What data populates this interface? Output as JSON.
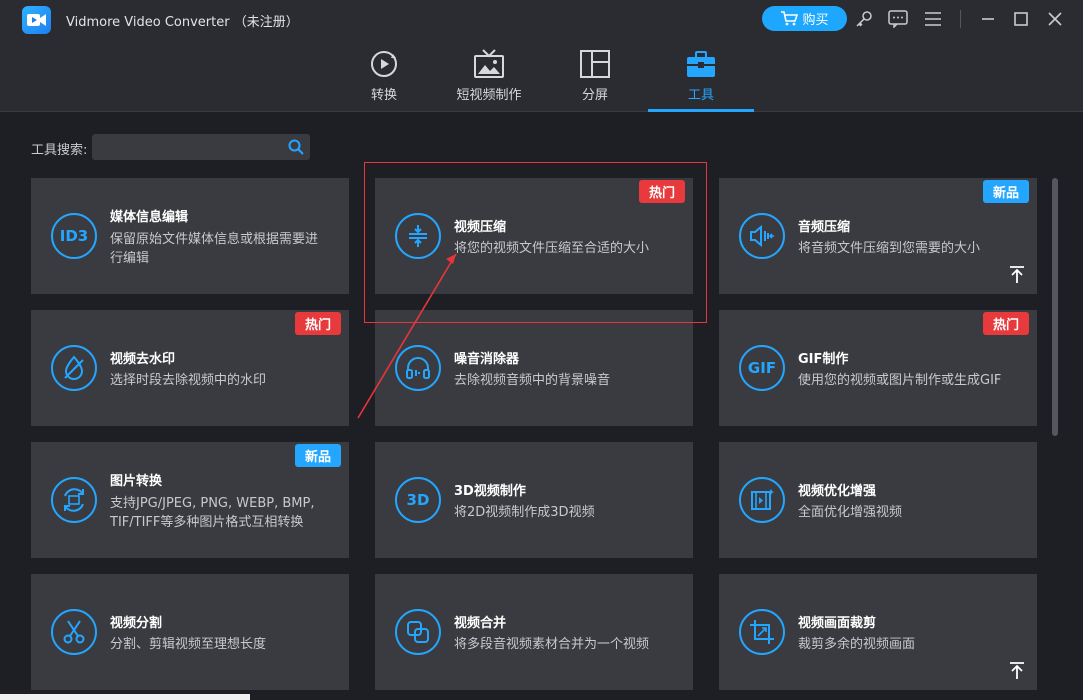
{
  "window": {
    "title": "Vidmore Video Converter （未注册）",
    "buy_label": "购买"
  },
  "nav": {
    "tabs": [
      {
        "label": "转换",
        "icon": "convert-icon"
      },
      {
        "label": "短视频制作",
        "icon": "mv-icon"
      },
      {
        "label": "分屏",
        "icon": "split-screen-icon"
      },
      {
        "label": "工具",
        "icon": "toolbox-icon",
        "active": true
      }
    ]
  },
  "search": {
    "label": "工具搜索:",
    "value": "",
    "placeholder": ""
  },
  "tools": [
    {
      "icon_text": "ID3",
      "icon": "id3-icon",
      "title": "媒体信息编辑",
      "desc": "保留原始文件媒体信息或根据需要进行编辑"
    },
    {
      "icon": "compress-icon",
      "title": "视频压缩",
      "desc": "将您的视频文件压缩至合适的大小",
      "badge": "热门"
    },
    {
      "icon": "audio-compress-icon",
      "title": "音频压缩",
      "desc": "将音频文件压缩到您需要的大小",
      "badge": "新品"
    },
    {
      "icon": "watermark-icon",
      "title": "视频去水印",
      "desc": "选择时段去除视频中的水印",
      "badge": "热门"
    },
    {
      "icon": "noise-remover-icon",
      "title": "噪音消除器",
      "desc": "去除视频音频中的背景噪音"
    },
    {
      "icon_text": "GIF",
      "icon": "gif-icon",
      "title": "GIF制作",
      "desc": "使用您的视频或图片制作或生成GIF",
      "badge": "热门"
    },
    {
      "icon": "image-convert-icon",
      "title": "图片转换",
      "desc": "支持JPG/JPEG, PNG, WEBP, BMP, TIF/TIFF等多种图片格式互相转换",
      "badge": "新品"
    },
    {
      "icon_text": "3D",
      "icon": "3d-icon",
      "title": "3D视频制作",
      "desc": "将2D视频制作成3D视频"
    },
    {
      "icon": "enhance-icon",
      "title": "视频优化增强",
      "desc": "全面优化增强视频"
    },
    {
      "icon": "scissors-icon",
      "title": "视频分割",
      "desc": "分割、剪辑视频至理想长度"
    },
    {
      "icon": "merge-icon",
      "title": "视频合并",
      "desc": "将多段音视频素材合并为一个视频"
    },
    {
      "icon": "crop-icon",
      "title": "视频画面裁剪",
      "desc": "裁剪多余的视频画面"
    }
  ],
  "colors": {
    "accent": "#24a6ff",
    "hot_badge": "#e83a3d",
    "card_bg": "#3a3b40",
    "page_bg": "#1e1f24",
    "annotation": "#e8353a"
  }
}
